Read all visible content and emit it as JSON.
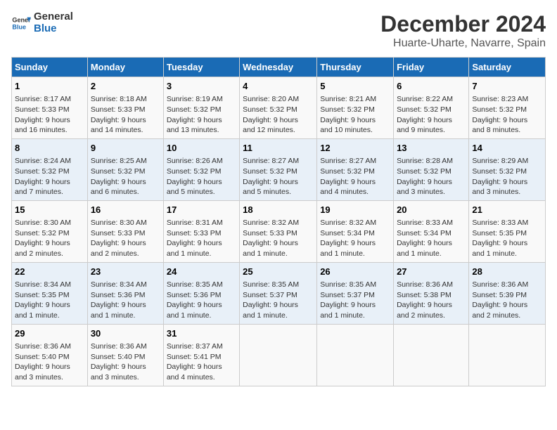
{
  "logo": {
    "text_general": "General",
    "text_blue": "Blue"
  },
  "title": "December 2024",
  "subtitle": "Huarte-Uharte, Navarre, Spain",
  "headers": [
    "Sunday",
    "Monday",
    "Tuesday",
    "Wednesday",
    "Thursday",
    "Friday",
    "Saturday"
  ],
  "weeks": [
    [
      {
        "day": "1",
        "info": "Sunrise: 8:17 AM\nSunset: 5:33 PM\nDaylight: 9 hours\nand 16 minutes."
      },
      {
        "day": "2",
        "info": "Sunrise: 8:18 AM\nSunset: 5:33 PM\nDaylight: 9 hours\nand 14 minutes."
      },
      {
        "day": "3",
        "info": "Sunrise: 8:19 AM\nSunset: 5:32 PM\nDaylight: 9 hours\nand 13 minutes."
      },
      {
        "day": "4",
        "info": "Sunrise: 8:20 AM\nSunset: 5:32 PM\nDaylight: 9 hours\nand 12 minutes."
      },
      {
        "day": "5",
        "info": "Sunrise: 8:21 AM\nSunset: 5:32 PM\nDaylight: 9 hours\nand 10 minutes."
      },
      {
        "day": "6",
        "info": "Sunrise: 8:22 AM\nSunset: 5:32 PM\nDaylight: 9 hours\nand 9 minutes."
      },
      {
        "day": "7",
        "info": "Sunrise: 8:23 AM\nSunset: 5:32 PM\nDaylight: 9 hours\nand 8 minutes."
      }
    ],
    [
      {
        "day": "8",
        "info": "Sunrise: 8:24 AM\nSunset: 5:32 PM\nDaylight: 9 hours\nand 7 minutes."
      },
      {
        "day": "9",
        "info": "Sunrise: 8:25 AM\nSunset: 5:32 PM\nDaylight: 9 hours\nand 6 minutes."
      },
      {
        "day": "10",
        "info": "Sunrise: 8:26 AM\nSunset: 5:32 PM\nDaylight: 9 hours\nand 5 minutes."
      },
      {
        "day": "11",
        "info": "Sunrise: 8:27 AM\nSunset: 5:32 PM\nDaylight: 9 hours\nand 5 minutes."
      },
      {
        "day": "12",
        "info": "Sunrise: 8:27 AM\nSunset: 5:32 PM\nDaylight: 9 hours\nand 4 minutes."
      },
      {
        "day": "13",
        "info": "Sunrise: 8:28 AM\nSunset: 5:32 PM\nDaylight: 9 hours\nand 3 minutes."
      },
      {
        "day": "14",
        "info": "Sunrise: 8:29 AM\nSunset: 5:32 PM\nDaylight: 9 hours\nand 3 minutes."
      }
    ],
    [
      {
        "day": "15",
        "info": "Sunrise: 8:30 AM\nSunset: 5:32 PM\nDaylight: 9 hours\nand 2 minutes."
      },
      {
        "day": "16",
        "info": "Sunrise: 8:30 AM\nSunset: 5:33 PM\nDaylight: 9 hours\nand 2 minutes."
      },
      {
        "day": "17",
        "info": "Sunrise: 8:31 AM\nSunset: 5:33 PM\nDaylight: 9 hours\nand 1 minute."
      },
      {
        "day": "18",
        "info": "Sunrise: 8:32 AM\nSunset: 5:33 PM\nDaylight: 9 hours\nand 1 minute."
      },
      {
        "day": "19",
        "info": "Sunrise: 8:32 AM\nSunset: 5:34 PM\nDaylight: 9 hours\nand 1 minute."
      },
      {
        "day": "20",
        "info": "Sunrise: 8:33 AM\nSunset: 5:34 PM\nDaylight: 9 hours\nand 1 minute."
      },
      {
        "day": "21",
        "info": "Sunrise: 8:33 AM\nSunset: 5:35 PM\nDaylight: 9 hours\nand 1 minute."
      }
    ],
    [
      {
        "day": "22",
        "info": "Sunrise: 8:34 AM\nSunset: 5:35 PM\nDaylight: 9 hours\nand 1 minute."
      },
      {
        "day": "23",
        "info": "Sunrise: 8:34 AM\nSunset: 5:36 PM\nDaylight: 9 hours\nand 1 minute."
      },
      {
        "day": "24",
        "info": "Sunrise: 8:35 AM\nSunset: 5:36 PM\nDaylight: 9 hours\nand 1 minute."
      },
      {
        "day": "25",
        "info": "Sunrise: 8:35 AM\nSunset: 5:37 PM\nDaylight: 9 hours\nand 1 minute."
      },
      {
        "day": "26",
        "info": "Sunrise: 8:35 AM\nSunset: 5:37 PM\nDaylight: 9 hours\nand 1 minute."
      },
      {
        "day": "27",
        "info": "Sunrise: 8:36 AM\nSunset: 5:38 PM\nDaylight: 9 hours\nand 2 minutes."
      },
      {
        "day": "28",
        "info": "Sunrise: 8:36 AM\nSunset: 5:39 PM\nDaylight: 9 hours\nand 2 minutes."
      }
    ],
    [
      {
        "day": "29",
        "info": "Sunrise: 8:36 AM\nSunset: 5:40 PM\nDaylight: 9 hours\nand 3 minutes."
      },
      {
        "day": "30",
        "info": "Sunrise: 8:36 AM\nSunset: 5:40 PM\nDaylight: 9 hours\nand 3 minutes."
      },
      {
        "day": "31",
        "info": "Sunrise: 8:37 AM\nSunset: 5:41 PM\nDaylight: 9 hours\nand 4 minutes."
      },
      null,
      null,
      null,
      null
    ]
  ]
}
